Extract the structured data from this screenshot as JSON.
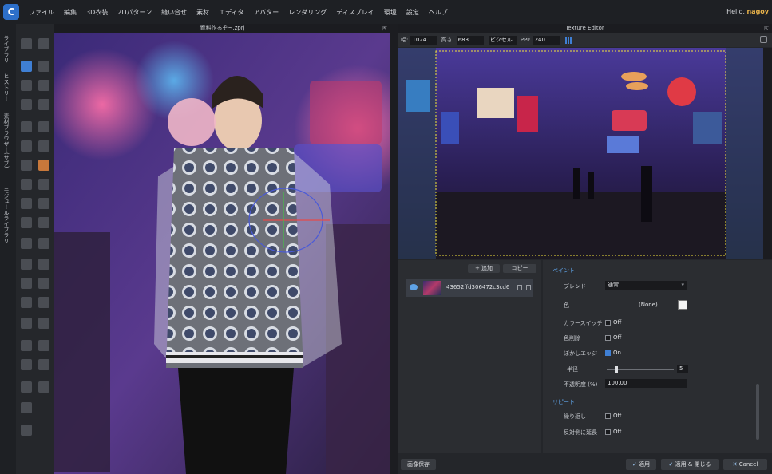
{
  "menubar": {
    "logo": "C",
    "items": [
      "ファイル",
      "編集",
      "3D衣装",
      "2Dパターン",
      "縫い合せ",
      "素材",
      "エディタ",
      "アバター",
      "レンダリング",
      "ディスプレイ",
      "環境",
      "設定",
      "ヘルプ"
    ],
    "greeting": "Hello,",
    "user": "nagoy"
  },
  "left_tabs": [
    "ライブラリ",
    "ヒストリー",
    "素材ブラウザー(サブ)",
    "モジュールライブラリ"
  ],
  "viewport": {
    "title": "資料作るぞ~.zprj"
  },
  "texture_editor": {
    "title": "Texture Editor",
    "width_label": "幅:",
    "width_value": "1024",
    "height_label": "高さ:",
    "height_value": "683",
    "unit": "ピクセル",
    "ppi_label": "PPI:",
    "ppi_value": "240"
  },
  "layers": {
    "add_label": "+ 追加",
    "copy_label": "コピー",
    "layer_name": "43652ffd306472c3cd6"
  },
  "props": {
    "paint_section": "ペイント",
    "blend_label": "ブレンド",
    "blend_value": "通常",
    "color_label": "色",
    "color_value": "(None)",
    "color_switch_label": "カラースイッチ",
    "color_switch_value": "Off",
    "color_remove_label": "色削除",
    "color_remove_value": "Off",
    "blur_edge_label": "ぼかしエッジ",
    "blur_edge_value": "On",
    "radius_label": "半径",
    "radius_value": "5",
    "radius_level": 0.12,
    "opacity_label": "不透明度 (%)",
    "opacity_value": "100.00",
    "repeat_section": "リピート",
    "repeat_label": "繰り返し",
    "repeat_value": "Off",
    "mirror_label": "反対側に延長",
    "mirror_value": "Off"
  },
  "footer": {
    "save_image_label": "画像保存",
    "apply_label": "適用",
    "apply_close_label": "適用 & 閉じる",
    "cancel_label": "Cancel"
  },
  "colors": {
    "accent": "#3f7fd4",
    "section": "#5ea2e6"
  }
}
